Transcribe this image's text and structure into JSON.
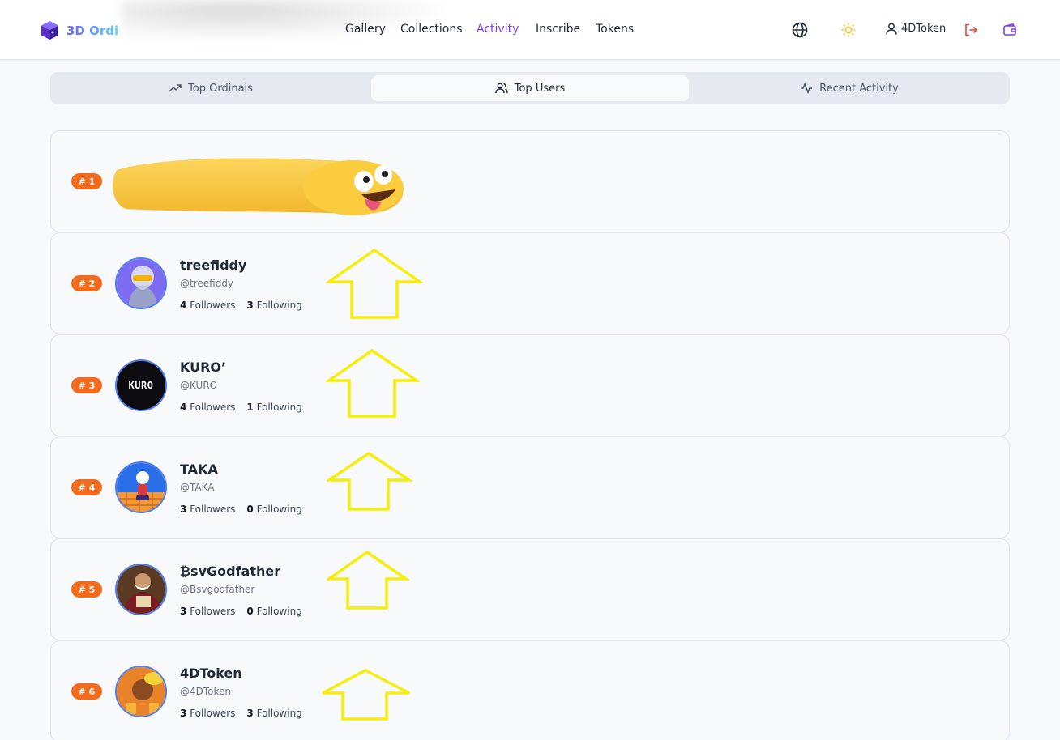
{
  "brand": {
    "name": "3D Ordi"
  },
  "nav": [
    {
      "label": "Gallery",
      "active": false
    },
    {
      "label": "Collections",
      "active": false
    },
    {
      "label": "Activity",
      "active": true
    },
    {
      "label": "Inscribe",
      "active": false
    },
    {
      "label": "Tokens",
      "active": false
    }
  ],
  "header": {
    "username": "4DToken"
  },
  "tabs": [
    {
      "label": "Top Ordinals",
      "icon": "trending-up-icon",
      "active": false
    },
    {
      "label": "Top Users",
      "icon": "users-icon",
      "active": true
    },
    {
      "label": "Recent Activity",
      "icon": "activity-icon",
      "active": false
    }
  ],
  "labels": {
    "followers": "Followers",
    "following": "Following"
  },
  "users": [
    {
      "rank": "# 1",
      "name": "",
      "handle": "",
      "followers": "",
      "following": "",
      "redacted": true
    },
    {
      "rank": "# 2",
      "name": "treefiddy",
      "handle": "@treefiddy",
      "followers": "4",
      "following": "3"
    },
    {
      "rank": "# 3",
      "name": "KURO’",
      "handle": "@KURO",
      "followers": "4",
      "following": "1",
      "avatar_text": "KURO"
    },
    {
      "rank": "# 4",
      "name": "TAKA",
      "handle": "@TAKA",
      "followers": "3",
      "following": "0"
    },
    {
      "rank": "# 5",
      "name": "₿svGodfather",
      "handle": "@Bsvgodfather",
      "followers": "3",
      "following": "0"
    },
    {
      "rank": "# 6",
      "name": "4DToken",
      "handle": "@4DToken",
      "followers": "3",
      "following": "3"
    }
  ],
  "colors": {
    "accent": "#7b3fe4",
    "rank_badge": "#f26a1b",
    "annotation_arrow": "#f5ee0a",
    "avatar_ring": "#4f7df0"
  }
}
